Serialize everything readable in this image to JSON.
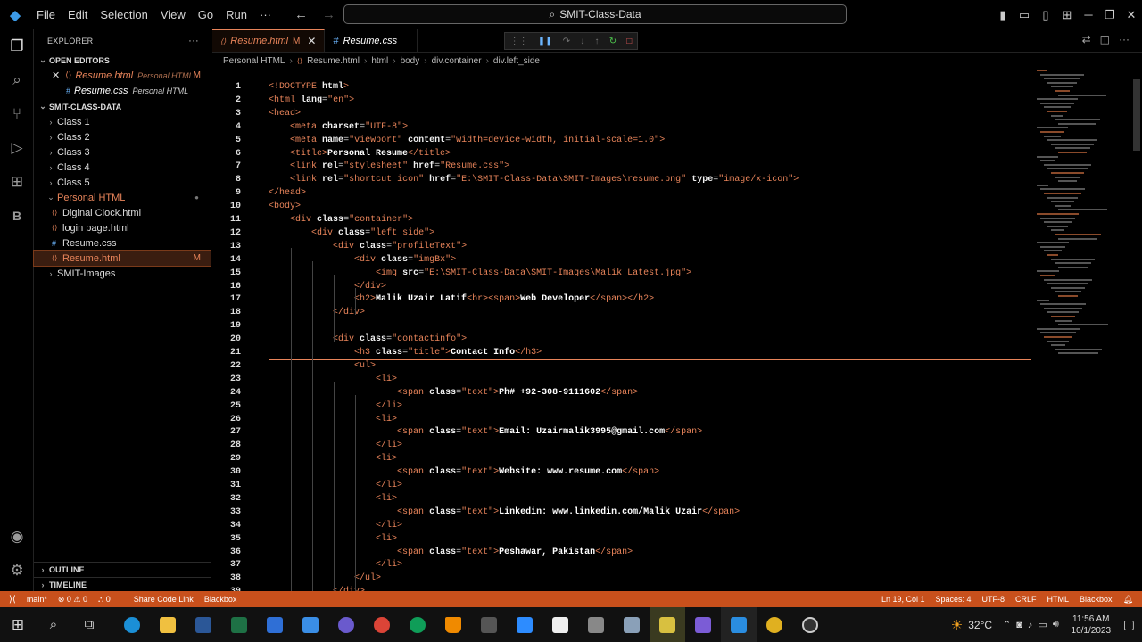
{
  "titlebar": {
    "menu": [
      "File",
      "Edit",
      "Selection",
      "View",
      "Go",
      "Run",
      "···"
    ],
    "search": "SMIT-Class-Data"
  },
  "explorer": {
    "title": "EXPLORER",
    "open_editors_label": "OPEN EDITORS",
    "open_editors": [
      {
        "name": "Resume.html",
        "desc": "Personal HTML",
        "badge": "M"
      },
      {
        "name": "Resume.css",
        "desc": "Personal HTML"
      }
    ],
    "workspace": "SMIT-CLASS-DATA",
    "tree": [
      {
        "name": "Class 1"
      },
      {
        "name": "Class 2"
      },
      {
        "name": "Class 3"
      },
      {
        "name": "Class 4"
      },
      {
        "name": "Class 5"
      },
      {
        "name": "Personal HTML"
      },
      {
        "name": "Diginal Clock.html"
      },
      {
        "name": "login page.html"
      },
      {
        "name": "Resume.css"
      },
      {
        "name": "Resume.html",
        "badge": "M"
      },
      {
        "name": "SMIT-Images"
      }
    ],
    "outline": "OUTLINE",
    "timeline": "TIMELINE"
  },
  "tabs": [
    {
      "name": "Resume.html",
      "badge": "M"
    },
    {
      "name": "Resume.css"
    }
  ],
  "breadcrumb": [
    "Personal HTML",
    "Resume.html",
    "html",
    "body",
    "div.container",
    "div.left_side"
  ],
  "code": [
    {
      "n": "1",
      "h": "<span class='t'>&lt;!DOCTYPE</span> <span class='a'>html</span><span class='t'>&gt;</span>"
    },
    {
      "n": "2",
      "h": "<span class='t'>&lt;html</span> <span class='a'>lang</span>=<span class='s'>\"en\"</span><span class='t'>&gt;</span>"
    },
    {
      "n": "3",
      "h": "<span class='t'>&lt;head&gt;</span>"
    },
    {
      "n": "4",
      "h": "    <span class='t'>&lt;meta</span> <span class='a'>charset</span>=<span class='s'>\"UTF-8\"</span><span class='t'>&gt;</span>"
    },
    {
      "n": "5",
      "h": "    <span class='t'>&lt;meta</span> <span class='a'>name</span>=<span class='s'>\"viewport\"</span> <span class='a'>content</span>=<span class='s'>\"width=device-width, initial-scale=1.0\"</span><span class='t'>&gt;</span>"
    },
    {
      "n": "6",
      "h": "    <span class='t'>&lt;title&gt;</span><span class='txt'>Personal Resume</span><span class='t'>&lt;/title&gt;</span>"
    },
    {
      "n": "7",
      "h": "    <span class='t'>&lt;link</span> <span class='a'>rel</span>=<span class='s'>\"stylesheet\"</span> <span class='a'>href</span>=<span class='s'>\"<u>Resume.css</u>\"</span><span class='t'>&gt;</span>"
    },
    {
      "n": "8",
      "h": "    <span class='t'>&lt;link</span> <span class='a'>rel</span>=<span class='s'>\"shortcut icon\"</span> <span class='a'>href</span>=<span class='s'>\"E:\\SMIT-Class-Data\\SMIT-Images\\resume.png\"</span> <span class='a'>type</span>=<span class='s'>\"image/x-icon\"</span><span class='t'>&gt;</span>"
    },
    {
      "n": "9",
      "h": "<span class='t'>&lt;/head&gt;</span>"
    },
    {
      "n": "10",
      "h": "<span class='t'>&lt;body&gt;</span>"
    },
    {
      "n": "11",
      "h": "    <span class='t'>&lt;div</span> <span class='a'>class</span>=<span class='s'>\"container\"</span><span class='t'>&gt;</span>"
    },
    {
      "n": "12",
      "h": "        <span class='t'>&lt;div</span> <span class='a'>class</span>=<span class='s'>\"left_side\"</span><span class='t'>&gt;</span>"
    },
    {
      "n": "13",
      "h": "            <span class='t'>&lt;div</span> <span class='a'>class</span>=<span class='s'>\"profileText\"</span><span class='t'>&gt;</span>"
    },
    {
      "n": "14",
      "h": "                <span class='t'>&lt;div</span> <span class='a'>class</span>=<span class='s'>\"imgBx\"</span><span class='t'>&gt;</span>"
    },
    {
      "n": "15",
      "h": "                    <span class='t'>&lt;img</span> <span class='a'>src</span>=<span class='s'>\"E:\\SMIT-Class-Data\\SMIT-Images\\Malik Latest.jpg\"</span><span class='t'>&gt;</span>"
    },
    {
      "n": "16",
      "h": "                <span class='t'>&lt;/div&gt;</span>"
    },
    {
      "n": "17",
      "h": "                <span class='t'>&lt;h2&gt;</span><span class='txt'>Malik Uzair Latif</span><span class='t'>&lt;br&gt;&lt;span&gt;</span><span class='txt'>Web Developer</span><span class='t'>&lt;/span&gt;&lt;/h2&gt;</span>"
    },
    {
      "n": "18",
      "h": "            <span class='t'>&lt;/div&gt;</span>"
    },
    {
      "n": "19",
      "h": ""
    },
    {
      "n": "20",
      "h": "            <span class='t'>&lt;div</span> <span class='a'>class</span>=<span class='s'>\"contactinfo\"</span><span class='t'>&gt;</span>"
    },
    {
      "n": "21",
      "h": "                <span class='t'>&lt;h3</span> <span class='a'>class</span>=<span class='s'>\"title\"</span><span class='t'>&gt;</span><span class='txt'>Contact Info</span><span class='t'>&lt;/h3&gt;</span>"
    },
    {
      "n": "22",
      "h": "                <span class='t'>&lt;ul&gt;</span>"
    },
    {
      "n": "23",
      "h": "                    <span class='t'>&lt;li&gt;</span>"
    },
    {
      "n": "24",
      "h": "                        <span class='t'>&lt;span</span> <span class='a'>class</span>=<span class='s'>\"text\"</span><span class='t'>&gt;</span><span class='txt'>Ph# +92-308-9111602</span><span class='t'>&lt;/span&gt;</span>"
    },
    {
      "n": "25",
      "h": "                    <span class='t'>&lt;/li&gt;</span>"
    },
    {
      "n": "26",
      "h": "                    <span class='t'>&lt;li&gt;</span>"
    },
    {
      "n": "27",
      "h": "                        <span class='t'>&lt;span</span> <span class='a'>class</span>=<span class='s'>\"text\"</span><span class='t'>&gt;</span><span class='txt'>Email: Uzairmalik3995@gmail.com</span><span class='t'>&lt;/span&gt;</span>"
    },
    {
      "n": "28",
      "h": "                    <span class='t'>&lt;/li&gt;</span>"
    },
    {
      "n": "29",
      "h": "                    <span class='t'>&lt;li&gt;</span>"
    },
    {
      "n": "30",
      "h": "                        <span class='t'>&lt;span</span> <span class='a'>class</span>=<span class='s'>\"text\"</span><span class='t'>&gt;</span><span class='txt'>Website: www.resume.com</span><span class='t'>&lt;/span&gt;</span>"
    },
    {
      "n": "31",
      "h": "                    <span class='t'>&lt;/li&gt;</span>"
    },
    {
      "n": "32",
      "h": "                    <span class='t'>&lt;li&gt;</span>"
    },
    {
      "n": "33",
      "h": "                        <span class='t'>&lt;span</span> <span class='a'>class</span>=<span class='s'>\"text\"</span><span class='t'>&gt;</span><span class='txt'>Linkedin: www.linkedin.com/Malik Uzair</span><span class='t'>&lt;/span&gt;</span>"
    },
    {
      "n": "34",
      "h": "                    <span class='t'>&lt;/li&gt;</span>"
    },
    {
      "n": "35",
      "h": "                    <span class='t'>&lt;li&gt;</span>"
    },
    {
      "n": "36",
      "h": "                        <span class='t'>&lt;span</span> <span class='a'>class</span>=<span class='s'>\"text\"</span><span class='t'>&gt;</span><span class='txt'>Peshawar, Pakistan</span><span class='t'>&lt;/span&gt;</span>"
    },
    {
      "n": "37",
      "h": "                    <span class='t'>&lt;/li&gt;</span>"
    },
    {
      "n": "38",
      "h": "                <span class='t'>&lt;/ul&gt;</span>"
    },
    {
      "n": "39",
      "h": "            <span class='t'>&lt;/div&gt;</span>"
    }
  ],
  "statusbar": {
    "branch": "main*",
    "problems": "⊗ 0 ⚠ 0",
    "ports": "⛬ 0",
    "share": "Share Code Link",
    "theme_left": "Blackbox",
    "position": "Ln 19, Col 1",
    "spaces": "Spaces: 4",
    "encoding": "UTF-8",
    "eol": "CRLF",
    "language": "HTML",
    "theme_right": "Blackbox"
  },
  "taskbar": {
    "temp": "32°C",
    "time": "11:56 AM",
    "date": "10/1/2023"
  },
  "colors": {
    "accent": "#e8845a",
    "status": "#c8501c"
  }
}
